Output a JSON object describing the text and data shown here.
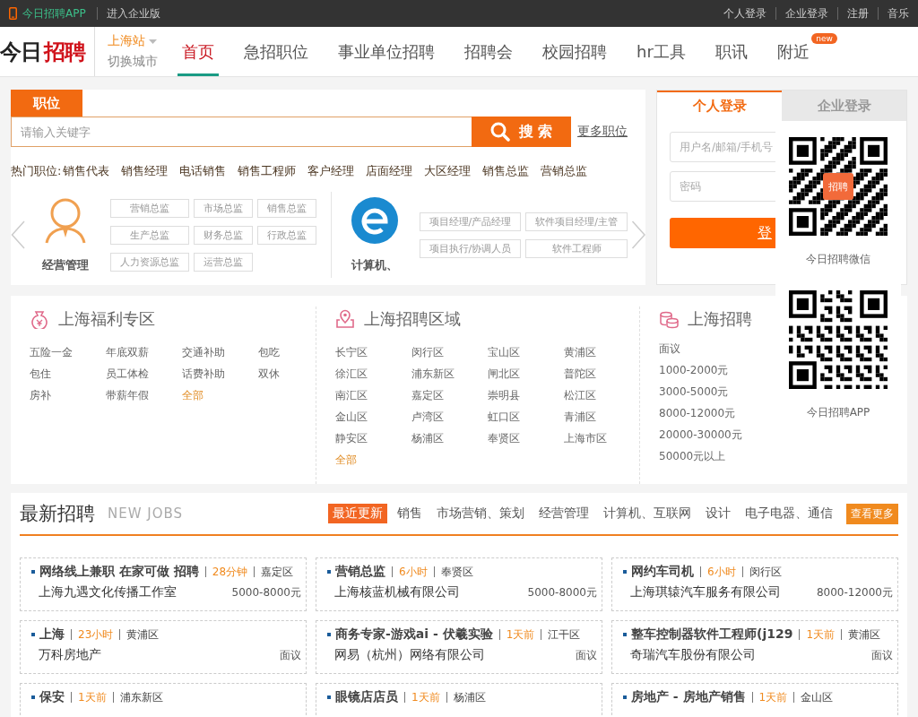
{
  "top_bar": {
    "app_link": "今日招聘APP",
    "enterprise_link": "进入企业版",
    "links": [
      "个人登录",
      "企业登录",
      "注册",
      "音乐"
    ]
  },
  "header": {
    "logo": {
      "first": "今日",
      "second": "招聘"
    },
    "city": "上海站",
    "switch_city": "切换城市",
    "nav": [
      {
        "label": "首页",
        "selected": true
      },
      {
        "label": "急招职位",
        "selected": false
      },
      {
        "label": "事业单位招聘",
        "selected": false
      },
      {
        "label": "招聘会",
        "selected": false
      },
      {
        "label": "校园招聘",
        "selected": false
      },
      {
        "label": "hr工具",
        "selected": false
      },
      {
        "label": "职讯",
        "selected": false
      },
      {
        "label": "附近",
        "selected": false,
        "badge": "new"
      }
    ]
  },
  "search": {
    "tab": "职位",
    "placeholder": "请输入关键字",
    "button": "搜 索",
    "more": "更多职位",
    "hot_label": "热门职位:",
    "hot": [
      "销售代表",
      "销售经理",
      "电话销售",
      "销售工程师",
      "客户经理",
      "店面经理",
      "大区经理",
      "销售总监",
      "营销总监"
    ]
  },
  "categories": [
    {
      "kind": "person",
      "title": "经营管理",
      "tags": [
        "营销总监",
        "市场总监",
        "销售总监",
        "生产总监",
        "财务总监",
        "行政总监",
        "人力资源总监",
        "运营总监"
      ]
    },
    {
      "kind": "browser",
      "title": "计算机、",
      "tags": [
        "项目经理/产品经理",
        "软件项目经理/主管",
        "项目执行/协调人员",
        "软件工程师"
      ]
    }
  ],
  "login": {
    "tabs": [
      {
        "label": "个人登录",
        "selected": true
      },
      {
        "label": "企业登录",
        "selected": false
      }
    ],
    "username_placeholder": "用户名/邮箱/手机号",
    "password_placeholder": "密码",
    "button": "登"
  },
  "qr_popup": [
    {
      "caption": "今日招聘微信",
      "logo_text": "招聘"
    },
    {
      "caption": "今日招聘APP"
    }
  ],
  "panels": [
    {
      "kind": "welfare",
      "title": "上海福利专区",
      "items": [
        {
          "label": "五险一金",
          "kind": "item"
        },
        {
          "label": "年底双薪",
          "kind": "item"
        },
        {
          "label": "交通补助",
          "kind": "item"
        },
        {
          "label": "包吃",
          "kind": "item"
        },
        {
          "label": "包住",
          "kind": "item"
        },
        {
          "label": "员工体检",
          "kind": "item"
        },
        {
          "label": "话费补助",
          "kind": "item"
        },
        {
          "label": "双休",
          "kind": "item"
        },
        {
          "label": "房补",
          "kind": "item"
        },
        {
          "label": "带薪年假",
          "kind": "item"
        },
        {
          "label": "全部",
          "kind": "all"
        }
      ]
    },
    {
      "kind": "area",
      "title": "上海招聘区域",
      "items": [
        {
          "label": "长宁区",
          "kind": "item"
        },
        {
          "label": "闵行区",
          "kind": "item"
        },
        {
          "label": "宝山区",
          "kind": "item"
        },
        {
          "label": "黄浦区",
          "kind": "item"
        },
        {
          "label": "徐汇区",
          "kind": "item"
        },
        {
          "label": "浦东新区",
          "kind": "item"
        },
        {
          "label": "闸北区",
          "kind": "item"
        },
        {
          "label": "普陀区",
          "kind": "item"
        },
        {
          "label": "南汇区",
          "kind": "item"
        },
        {
          "label": "嘉定区",
          "kind": "item"
        },
        {
          "label": "崇明县",
          "kind": "item"
        },
        {
          "label": "松江区",
          "kind": "item"
        },
        {
          "label": "金山区",
          "kind": "item"
        },
        {
          "label": "卢湾区",
          "kind": "item"
        },
        {
          "label": "虹口区",
          "kind": "item"
        },
        {
          "label": "青浦区",
          "kind": "item"
        },
        {
          "label": "静安区",
          "kind": "item"
        },
        {
          "label": "杨浦区",
          "kind": "item"
        },
        {
          "label": "奉贤区",
          "kind": "item"
        },
        {
          "label": "上海市区",
          "kind": "item"
        },
        {
          "label": "全部",
          "kind": "all"
        }
      ]
    },
    {
      "kind": "salary",
      "title": "上海招聘",
      "items": [
        {
          "label": "面议",
          "kind": "item"
        },
        {
          "label": "1000-2000元",
          "kind": "item"
        },
        {
          "label": "3000-5000元",
          "kind": "item"
        },
        {
          "label": "8000-12000元",
          "kind": "item"
        },
        {
          "label": "20000-30000元",
          "kind": "item"
        },
        {
          "label": "50000元以上",
          "kind": "item"
        }
      ]
    }
  ],
  "jobs": {
    "title": "最新招聘",
    "subtitle": "NEW JOBS",
    "tabs": [
      {
        "label": "最近更新",
        "selected": true
      },
      {
        "label": "销售",
        "selected": false
      },
      {
        "label": "市场营销、策划",
        "selected": false
      },
      {
        "label": "经营管理",
        "selected": false
      },
      {
        "label": "计算机、互联网",
        "selected": false
      },
      {
        "label": "设计",
        "selected": false
      },
      {
        "label": "电子电器、通信",
        "selected": false
      }
    ],
    "more": "查看更多",
    "cards": [
      {
        "title": "网络线上兼职 在家可做 招聘",
        "time": "28分钟",
        "area": "嘉定区",
        "company": "上海九遇文化传播工作室",
        "salary": "5000-8000元"
      },
      {
        "title": "营销总监",
        "time": "6小时",
        "area": "奉贤区",
        "company": "上海核蓝机械有限公司",
        "salary": "5000-8000元"
      },
      {
        "title": "网约车司机",
        "time": "6小时",
        "area": "闵行区",
        "company": "上海琪辕汽车服务有限公司",
        "salary": "8000-12000元"
      },
      {
        "title": "上海",
        "time": "23小时",
        "area": "黄浦区",
        "company": "万科房地产",
        "salary": "面议"
      },
      {
        "title": "商务专家-游戏ai - 伏羲实验",
        "time": "1天前",
        "area": "江干区",
        "company": "网易（杭州）网络有限公司",
        "salary": "面议"
      },
      {
        "title": "整车控制器软件工程师(j129",
        "time": "1天前",
        "area": "黄浦区",
        "company": "奇瑞汽车股份有限公司",
        "salary": "面议"
      },
      {
        "title": "保安",
        "time": "1天前",
        "area": "浦东新区"
      },
      {
        "title": "眼镜店店员",
        "time": "1天前",
        "area": "杨浦区"
      },
      {
        "title": "房地产 - 房地产销售",
        "time": "1天前",
        "area": "金山区"
      }
    ]
  }
}
